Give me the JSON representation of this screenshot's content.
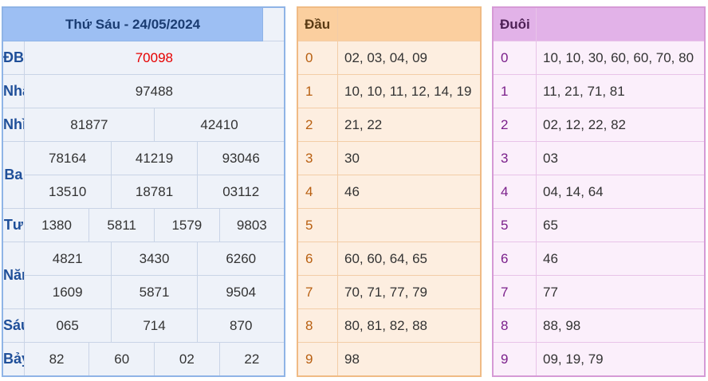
{
  "results": {
    "title": "Thứ Sáu - 24/05/2024",
    "db": {
      "label": "ĐB",
      "value": "70098"
    },
    "nhat": {
      "label": "Nhất",
      "value": "97488"
    },
    "nhi": {
      "label": "Nhì",
      "values": [
        "81877",
        "42410"
      ]
    },
    "ba": {
      "label": "Ba",
      "values": [
        "78164",
        "41219",
        "93046",
        "13510",
        "18781",
        "03112"
      ]
    },
    "tu": {
      "label": "Tư",
      "values": [
        "1380",
        "5811",
        "1579",
        "9803"
      ]
    },
    "nam": {
      "label": "Năm",
      "values": [
        "4821",
        "3430",
        "6260",
        "1609",
        "5871",
        "9504"
      ]
    },
    "sau": {
      "label": "Sáu",
      "values": [
        "065",
        "714",
        "870"
      ]
    },
    "bay": {
      "label": "Bảy",
      "values": [
        "82",
        "60",
        "02",
        "22"
      ]
    }
  },
  "dau": {
    "header": "Đầu",
    "rows": [
      {
        "key": "0",
        "value": "02, 03, 04, 09"
      },
      {
        "key": "1",
        "value": "10, 10, 11, 12, 14, 19"
      },
      {
        "key": "2",
        "value": "21, 22"
      },
      {
        "key": "3",
        "value": "30"
      },
      {
        "key": "4",
        "value": "46"
      },
      {
        "key": "5",
        "value": ""
      },
      {
        "key": "6",
        "value": "60, 60, 64, 65"
      },
      {
        "key": "7",
        "value": "70, 71, 77, 79"
      },
      {
        "key": "8",
        "value": "80, 81, 82, 88"
      },
      {
        "key": "9",
        "value": "98"
      }
    ]
  },
  "duoi": {
    "header": "Đuôi",
    "rows": [
      {
        "key": "0",
        "value": "10, 10, 30, 60, 60, 70, 80"
      },
      {
        "key": "1",
        "value": "11, 21, 71, 81"
      },
      {
        "key": "2",
        "value": "02, 12, 22, 82"
      },
      {
        "key": "3",
        "value": "03"
      },
      {
        "key": "4",
        "value": "04, 14, 64"
      },
      {
        "key": "5",
        "value": "65"
      },
      {
        "key": "6",
        "value": "46"
      },
      {
        "key": "7",
        "value": "77"
      },
      {
        "key": "8",
        "value": "88, 98"
      },
      {
        "key": "9",
        "value": "09, 19, 79"
      }
    ]
  },
  "colors": {
    "special_prize": "#e60000",
    "prize_label": "#1f4f99",
    "results_header": "#9dbff3",
    "dau_header": "#fbcf9f",
    "duoi_header": "#e2b2e8"
  }
}
